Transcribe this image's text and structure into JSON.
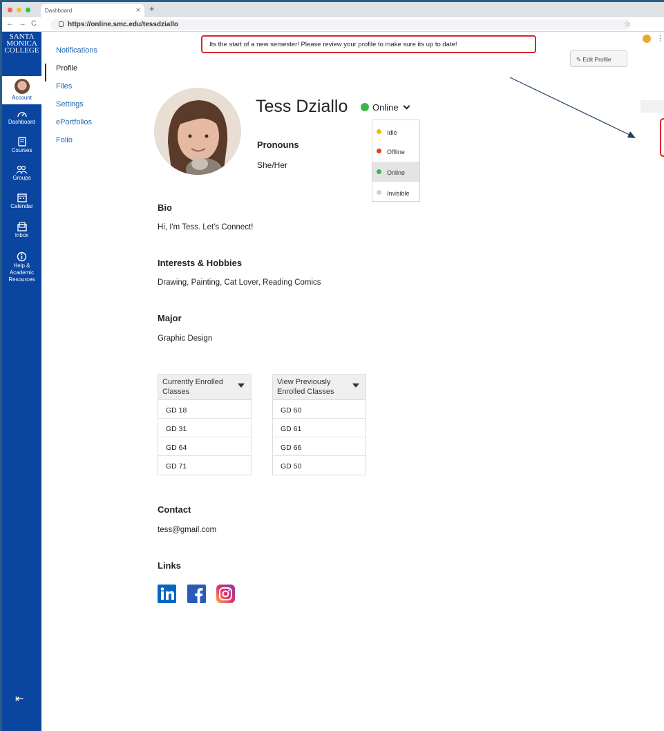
{
  "browser": {
    "tab_title": "Dashboard",
    "tab_close": "×",
    "new_tab": "+",
    "url": "https://online.smc.edu/tessdziallo"
  },
  "global_nav": {
    "logo_lines": [
      "SANTA",
      "MONICA",
      "COLLEGE"
    ],
    "items": [
      {
        "label": "Account",
        "icon": "account-avatar-icon"
      },
      {
        "label": "Dashboard",
        "icon": "dashboard-gauge-icon"
      },
      {
        "label": "Courses",
        "icon": "courses-book-icon"
      },
      {
        "label": "Groups",
        "icon": "groups-people-icon"
      },
      {
        "label": "Calendar",
        "icon": "calendar-icon"
      },
      {
        "label": "Inbox",
        "icon": "inbox-icon"
      },
      {
        "label": "Help &",
        "icon": "help-icon"
      },
      {
        "label": "Academic",
        "icon": ""
      },
      {
        "label": "Resources",
        "icon": ""
      }
    ],
    "collapse": "⇤"
  },
  "sub_nav": {
    "items": [
      "Notifications",
      "Profile",
      "Files",
      "Settings",
      "ePortfolios",
      "Folio"
    ],
    "active": "Profile"
  },
  "banner": {
    "text": "Its the start of a new semester! Please review your profile to make sure its up to date!"
  },
  "edit_profile": "Edit Profile",
  "profile": {
    "name": "Tess Dziallo",
    "status": "Online",
    "status_caret": "⌄",
    "status_options": [
      {
        "label": "Idle",
        "color": "#f5b800"
      },
      {
        "label": "Offline",
        "color": "#e83b1a"
      },
      {
        "label": "Online",
        "color": "#3fb54a"
      },
      {
        "label": "Invisible",
        "color": "#d0d0d0"
      }
    ],
    "pronouns_heading": "Pronouns",
    "pronouns": "She/Her",
    "bio_heading": "Bio",
    "bio": "Hi, I'm Tess. Let's Connect!",
    "interests_heading": "Interests & Hobbies",
    "interests": "Drawing, Painting, Cat Lover, Reading Comics",
    "major_heading": "Major",
    "major": "Graphic Design",
    "current_classes": {
      "header_lines": [
        "Currently Enrolled",
        "Classes"
      ],
      "rows": [
        "GD 18",
        "GD 31",
        "GD 64",
        "GD 71"
      ]
    },
    "previous_classes": {
      "header_lines": [
        "View Previously",
        "Enrolled Classes"
      ],
      "rows": [
        "GD 60",
        "GD 61",
        "GD 66",
        "GD 50"
      ]
    },
    "contact_heading": "Contact",
    "contact": "tess@gmail.com",
    "links_heading": "Links",
    "links": [
      "linkedin-icon",
      "facebook-icon",
      "instagram-icon"
    ]
  },
  "colors": {
    "nav_blue": "#0a45a0",
    "link_blue": "#1d65b3",
    "alert_red": "#d8232a",
    "online_green": "#3fb54a"
  }
}
